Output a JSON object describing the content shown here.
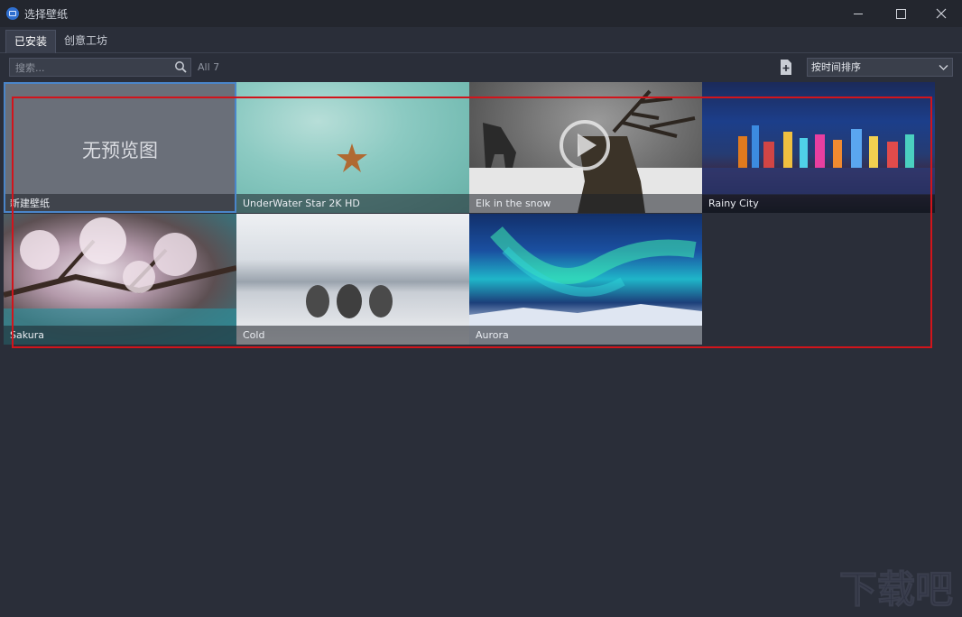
{
  "window": {
    "title": "选择壁纸"
  },
  "tabs": [
    {
      "label": "已安装",
      "active": true
    },
    {
      "label": "创意工坊",
      "active": false
    }
  ],
  "toolbar": {
    "search_placeholder": "搜索...",
    "count_label": "All 7",
    "sort_selected": "按时间排序"
  },
  "wallpapers": [
    {
      "caption": "新建壁纸",
      "preview_text": "无预览图",
      "selected": true
    },
    {
      "caption": "UnderWater Star 2K HD"
    },
    {
      "caption": "Elk in the snow",
      "is_video": true
    },
    {
      "caption": "Rainy City"
    },
    {
      "caption": "Sakura"
    },
    {
      "caption": "Cold"
    },
    {
      "caption": "Aurora"
    }
  ],
  "colors": {
    "background": "#2a2e39",
    "selection": "#4a85c9",
    "annotation_box": "#d2141b"
  },
  "watermark": "下载吧"
}
